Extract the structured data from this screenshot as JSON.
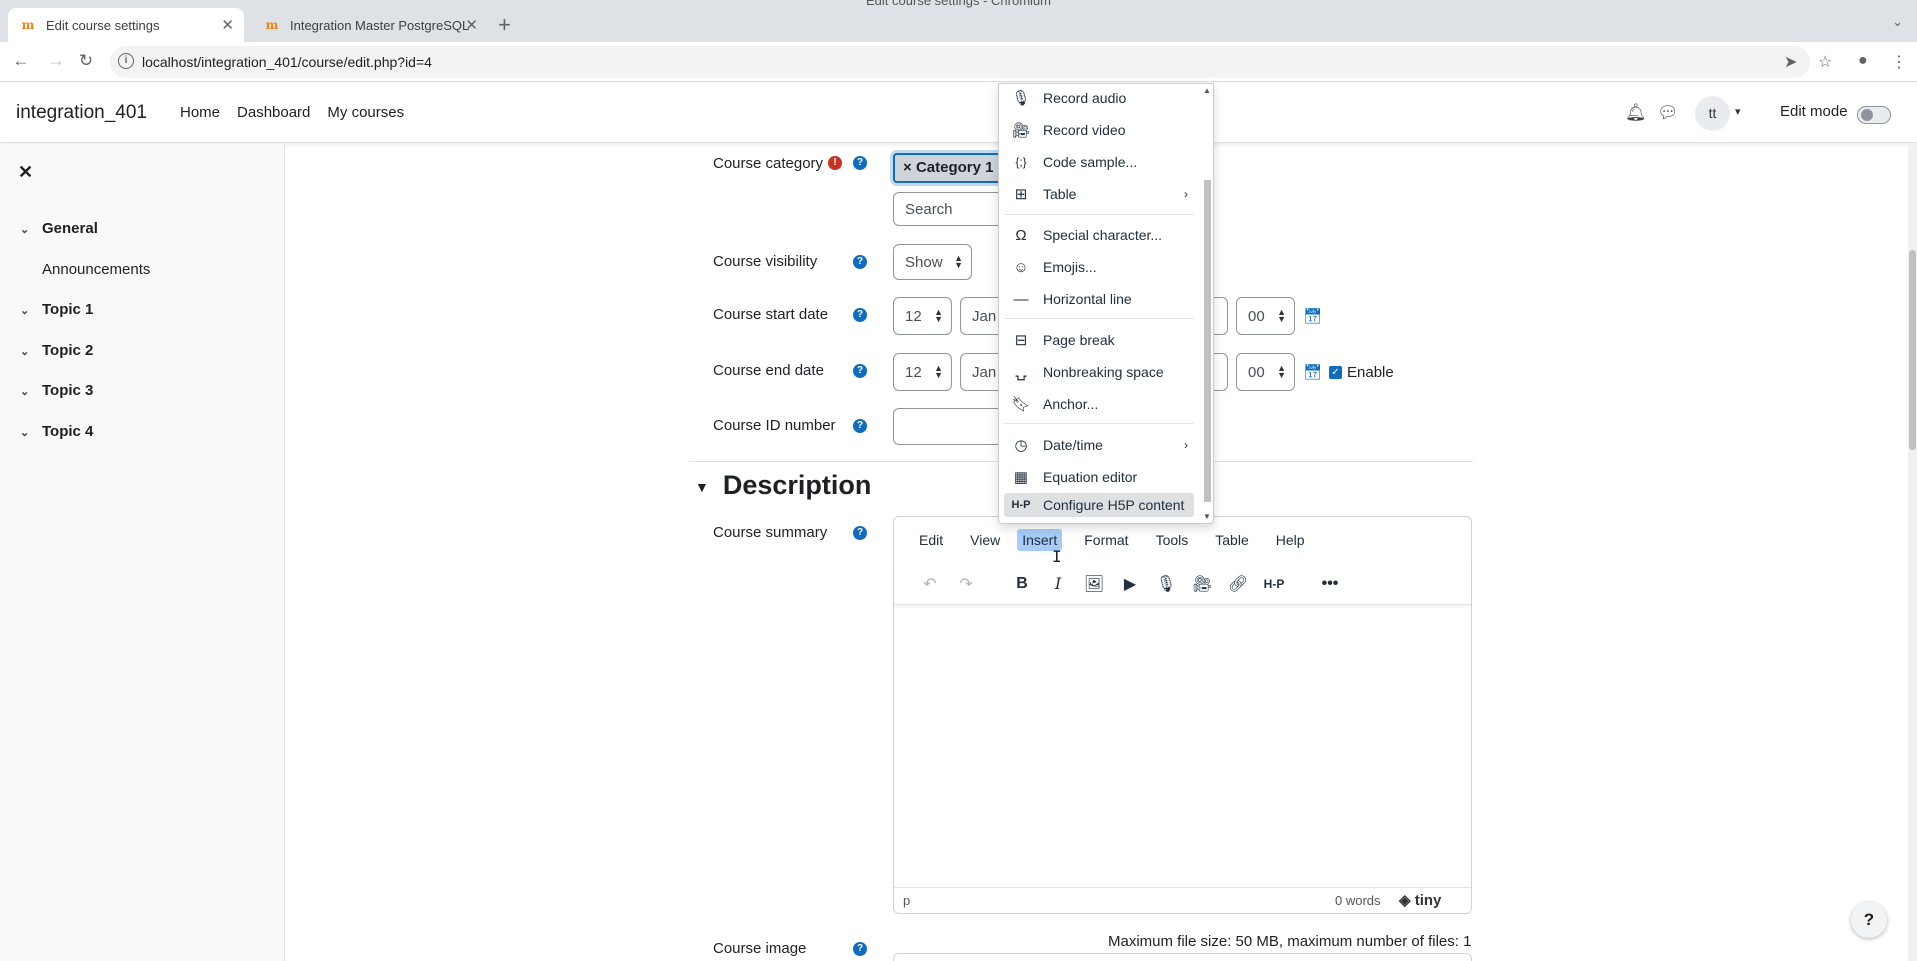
{
  "browser": {
    "window_title": "Edit course settings - Chromium",
    "tabs": [
      {
        "title": "Edit course settings"
      },
      {
        "title": "Integration Master PostgreSQL"
      }
    ],
    "url": "localhost/integration_401/course/edit.php?id=4"
  },
  "navbar": {
    "brand": "integration_401",
    "links": [
      "Home",
      "Dashboard",
      "My courses"
    ],
    "avatar_initials": "tt",
    "edit_mode_label": "Edit mode"
  },
  "drawer": {
    "items": [
      {
        "label": "General"
      },
      {
        "label": "Announcements"
      },
      {
        "label": "Topic 1"
      },
      {
        "label": "Topic 2"
      },
      {
        "label": "Topic 3"
      },
      {
        "label": "Topic 4"
      }
    ]
  },
  "form": {
    "category": {
      "label": "Course category",
      "selected": "Category 1",
      "search_placeholder": "Search"
    },
    "visibility": {
      "label": "Course visibility",
      "value": "Show"
    },
    "start_date": {
      "label": "Course start date",
      "day": "12",
      "month": "Jan",
      "minute": "00"
    },
    "end_date": {
      "label": "Course end date",
      "day": "12",
      "month": "Jan",
      "minute": "00",
      "enable_label": "Enable"
    },
    "id_number": {
      "label": "Course ID number"
    },
    "description_heading": "Description",
    "summary_label": "Course summary",
    "image_label": "Course image",
    "file_info": "Maximum file size: 50 MB, maximum number of files: 1"
  },
  "editor": {
    "menubar": [
      "Edit",
      "View",
      "Insert",
      "Format",
      "Tools",
      "Table",
      "Help"
    ],
    "active_menu": "Insert",
    "status_path": "p",
    "word_count": "0 words",
    "brand": "tiny"
  },
  "insert_menu": {
    "items": [
      {
        "label": "Record audio",
        "icon": "microphone-icon"
      },
      {
        "label": "Record video",
        "icon": "video-camera-icon"
      },
      {
        "label": "Code sample...",
        "icon": "code-sample-icon"
      },
      {
        "label": "Table",
        "icon": "table-icon"
      },
      {
        "label": "Special character...",
        "icon": "omega-icon"
      },
      {
        "label": "Emojis...",
        "icon": "emoji-icon"
      },
      {
        "label": "Horizontal line",
        "icon": "horizontal-line-icon"
      },
      {
        "label": "Page break",
        "icon": "page-break-icon"
      },
      {
        "label": "Nonbreaking space",
        "icon": "nonbreaking-space-icon"
      },
      {
        "label": "Anchor...",
        "icon": "bookmark-icon"
      },
      {
        "label": "Date/time",
        "icon": "clock-icon"
      },
      {
        "label": "Equation editor",
        "icon": "calculator-icon"
      },
      {
        "label": "Configure H5P content",
        "icon": "h5p-icon"
      }
    ]
  },
  "help_button": "?",
  "colors": {
    "accent": "#0f6cbf",
    "required": "#ca3120",
    "menu_active": "#a6ccf7"
  }
}
